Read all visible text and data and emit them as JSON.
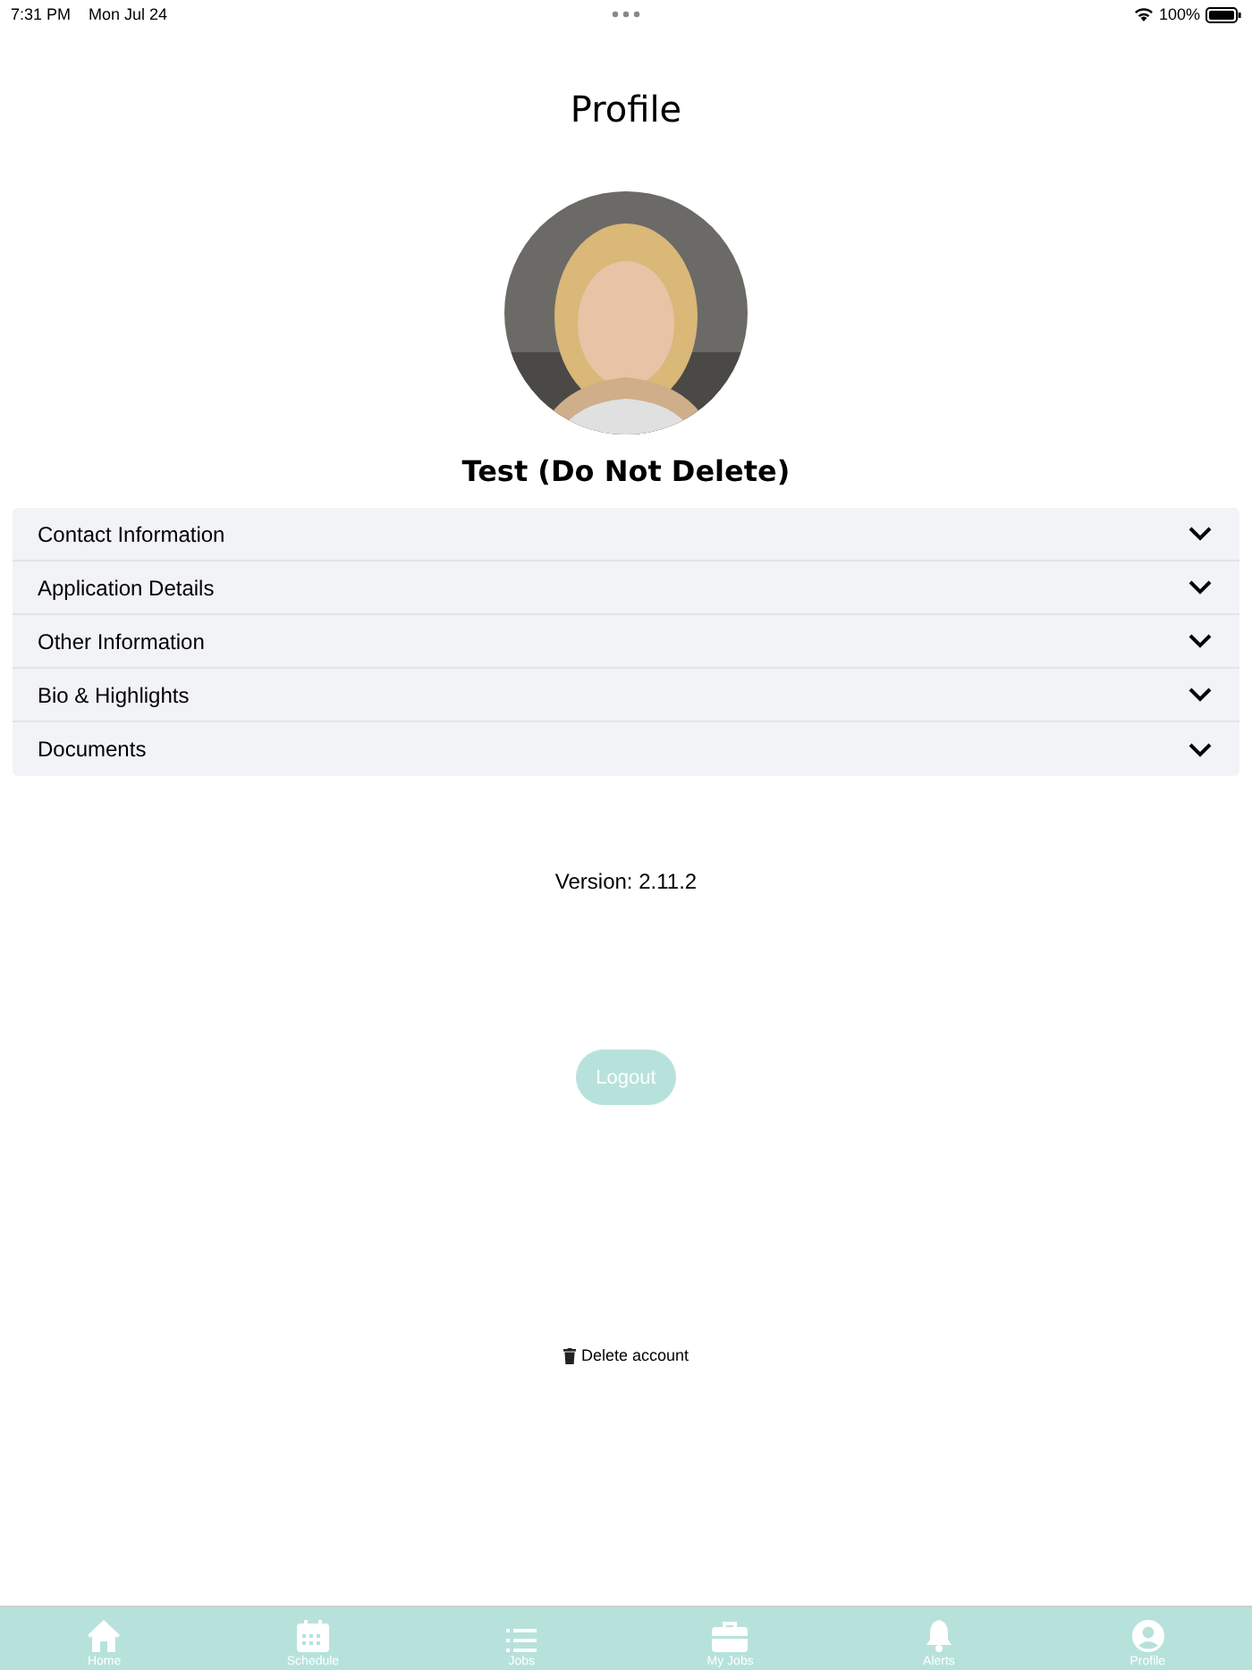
{
  "status_bar": {
    "time": "7:31 PM",
    "date": "Mon Jul 24",
    "battery": "100%"
  },
  "title": "Profile",
  "profile": {
    "name": "Test (Do Not Delete)"
  },
  "sections": [
    {
      "label": "Contact Information",
      "expanded": false
    },
    {
      "label": "Application Details",
      "expanded": false
    },
    {
      "label": "Other Information",
      "expanded": false
    },
    {
      "label": "Bio & Highlights",
      "expanded": false
    },
    {
      "label": "Documents",
      "expanded": false
    }
  ],
  "version": "Version: 2.11.2",
  "logout_button": "Logout",
  "delete_link": "Delete account",
  "tab_bar": [
    {
      "kind": "home",
      "label": "Home"
    },
    {
      "kind": "schedule",
      "label": "Schedule"
    },
    {
      "kind": "jobs",
      "label": "Jobs"
    },
    {
      "kind": "myjobs",
      "label": "My Jobs"
    },
    {
      "kind": "alerts",
      "label": "Alerts"
    },
    {
      "kind": "profile",
      "label": "Profile"
    }
  ]
}
